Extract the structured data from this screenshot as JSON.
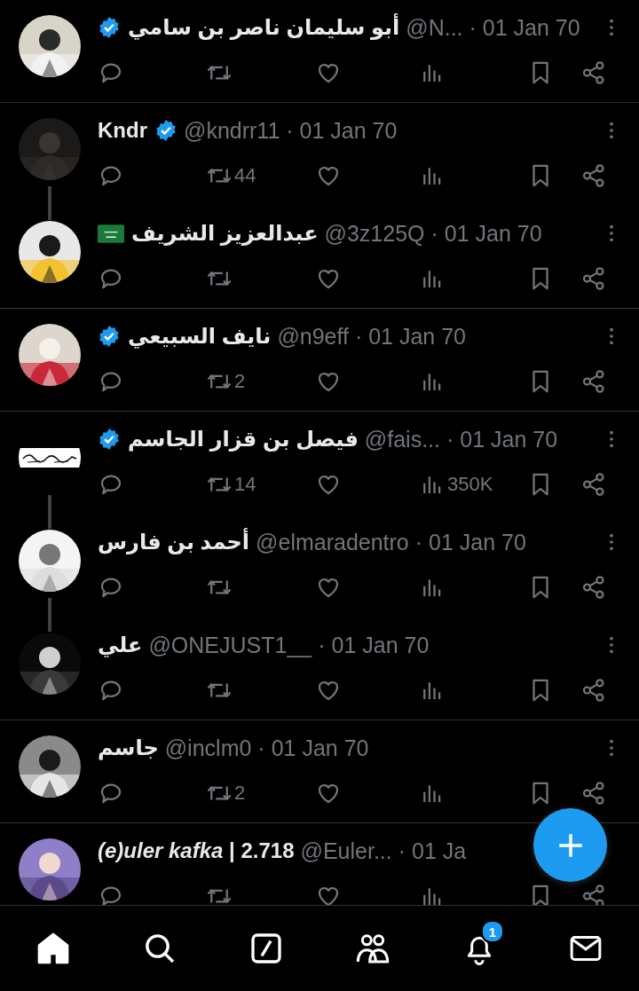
{
  "posts": [
    {
      "name": "أبو سليمان ناصر بن سامي",
      "verified": true,
      "handle": "@N...",
      "time": "· 01 Jan 70",
      "thread_continues": false
    },
    {
      "name": "Kndr",
      "verified": true,
      "handle": "@kndrr11",
      "time": "· 01 Jan 70",
      "thread_continues": true,
      "reposts": "44"
    },
    {
      "name": "عبدالعزيز الشريف",
      "verified": false,
      "flag": true,
      "handle": "@3z125Q",
      "time": "· 01 Jan 70",
      "thread_continues": false
    },
    {
      "name": "نايف السبيعي",
      "verified": true,
      "handle": "@n9eff",
      "time": "· 01 Jan 70",
      "thread_continues": false,
      "reposts": "2"
    },
    {
      "name": "فيصل بن قزار الجاسم",
      "verified": true,
      "handle": "@fais...",
      "time": "· 01 Jan 70",
      "thread_continues": true,
      "reposts": "14",
      "views": "350K"
    },
    {
      "name": "أحمد بن فارس",
      "verified": false,
      "handle": "@elmaradentro",
      "time": "· 01 Jan 70",
      "thread_continues": true
    },
    {
      "name": "علي",
      "verified": false,
      "handle": "@ONEJUST1__",
      "time": "· 01 Jan 70",
      "thread_continues": false
    },
    {
      "name": "جاسم",
      "verified": false,
      "handle": "@inclm0",
      "time": "· 01 Jan 70",
      "thread_continues": false,
      "reposts": "2"
    },
    {
      "name": "*(e)uler kafka* | 2.718",
      "verified": false,
      "handle": "@Euler...",
      "time": "· 01 Ja"
    }
  ],
  "nav": [
    {
      "kind": "home",
      "selected": true
    },
    {
      "kind": "search",
      "selected": false
    },
    {
      "kind": "grok",
      "selected": false
    },
    {
      "kind": "communities",
      "selected": false
    },
    {
      "kind": "notifications",
      "selected": false,
      "badge": "1"
    },
    {
      "kind": "messages",
      "selected": false
    }
  ]
}
